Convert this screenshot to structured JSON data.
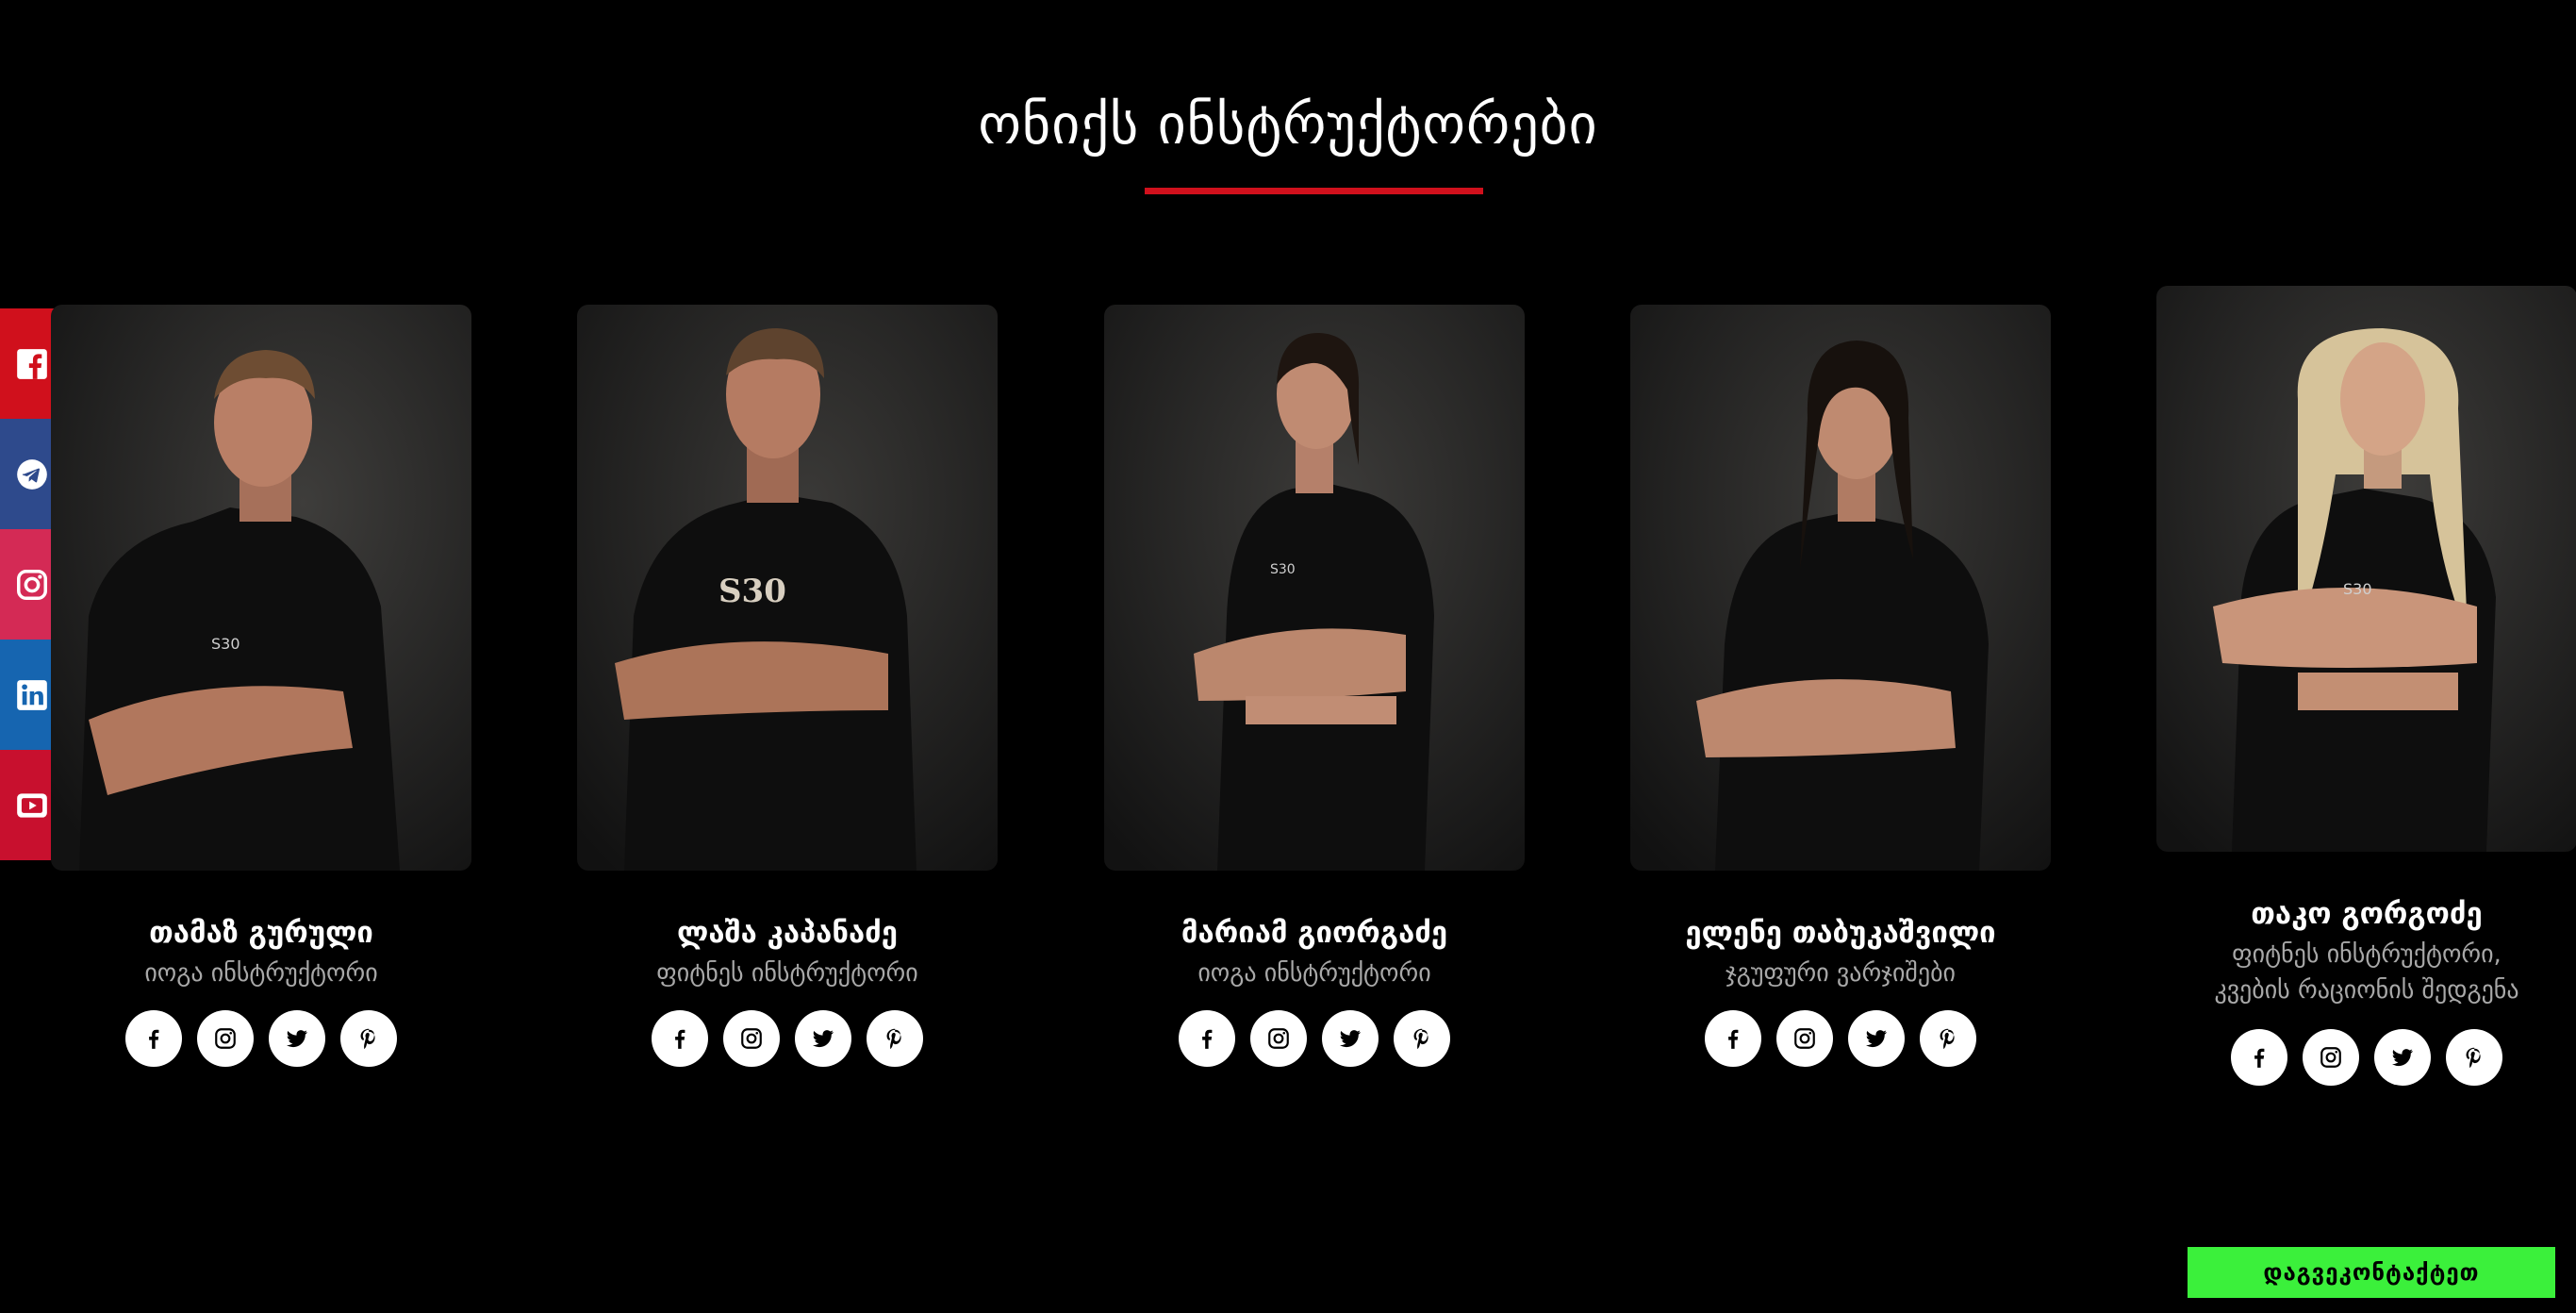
{
  "section": {
    "title": "ონიქს ინსტრუქტორები",
    "accent_color": "#d0101c"
  },
  "side_social_rail": [
    {
      "icon": "facebook-square-icon",
      "color": "#d0101c"
    },
    {
      "icon": "telegram-icon",
      "color": "#2e4a8c"
    },
    {
      "icon": "instagram-icon",
      "color": "#d42a55"
    },
    {
      "icon": "linkedin-icon",
      "color": "#1665b0"
    },
    {
      "icon": "youtube-icon",
      "color": "#c8102e"
    }
  ],
  "instructors": [
    {
      "name": "თამაზ გურული",
      "role": "იოგა ინსტრუქტორი",
      "role_line2": ""
    },
    {
      "name": "ლაშა კაპანაძე",
      "role": "ფიტნეს ინსტრუქტორი",
      "role_line2": ""
    },
    {
      "name": "მარიამ გიორგაძე",
      "role": "იოგა ინსტრუქტორი",
      "role_line2": ""
    },
    {
      "name": "ელენე თაბუკაშვილი",
      "role": "ჯგუფური ვარჯიშები",
      "role_line2": ""
    },
    {
      "name": "თაკო გორგოძე",
      "role": "ფიტნეს ინსტრუქტორი,",
      "role_line2": "კვების რაციონის შედგენა"
    }
  ],
  "card_social_icons": [
    "facebook-icon",
    "instagram-icon",
    "twitter-icon",
    "pinterest-icon"
  ],
  "contact_button": {
    "label": "დაგვეკონტაქტეთ",
    "color": "#3bf03b"
  }
}
